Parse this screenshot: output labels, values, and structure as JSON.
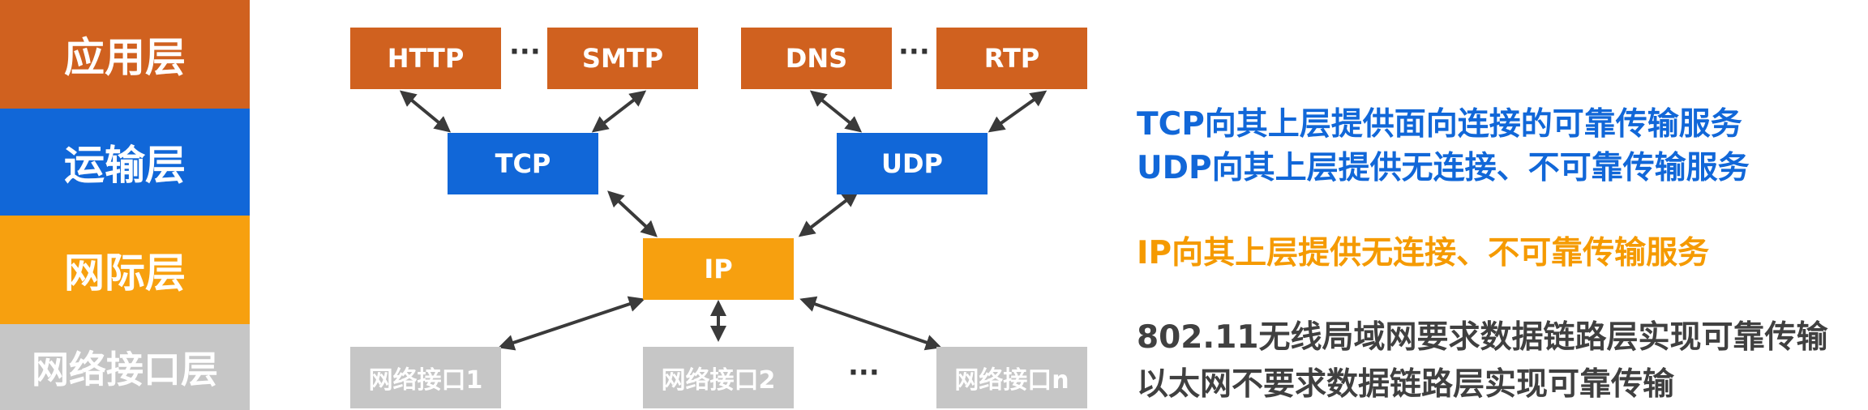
{
  "layers": [
    {
      "label": "应用层",
      "color": "#d0611f"
    },
    {
      "label": "运输层",
      "color": "#1167d8"
    },
    {
      "label": "网际层",
      "color": "#f7a00f"
    },
    {
      "label": "网络接口层",
      "color": "#c6c6c6"
    }
  ],
  "app_protocols": {
    "http": "HTTP",
    "smtp": "SMTP",
    "dns": "DNS",
    "rtp": "RTP",
    "ellipsis": "···"
  },
  "transport": {
    "tcp": "TCP",
    "udp": "UDP"
  },
  "network": {
    "ip": "IP"
  },
  "interfaces": {
    "if1": "网络接口1",
    "if2": "网络接口2",
    "ifn": "网络接口n",
    "ellipsis": "···"
  },
  "notes": {
    "tcp": "TCP向其上层提供面向连接的可靠传输服务",
    "udp": "UDP向其上层提供无连接、不可靠传输服务",
    "ip": "IP向其上层提供无连接、不可靠传输服务",
    "wifi": "802.11无线局域网要求数据链路层实现可靠传输",
    "ethernet": "以太网不要求数据链路层实现可靠传输"
  }
}
